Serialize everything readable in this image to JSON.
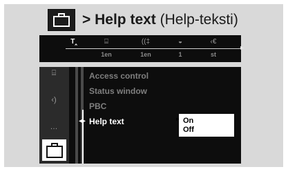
{
  "title": {
    "arrow": ">",
    "main": "Help text",
    "sub": "(Help-teksti)",
    "icon": "briefcase-icon"
  },
  "topbar": {
    "items": [
      {
        "icon": "settings-tools-icon",
        "glyph": "T‸",
        "label": "",
        "active": true
      },
      {
        "icon": "subtitle-icon",
        "glyph": "⌸",
        "label": "1en"
      },
      {
        "icon": "audio-language-icon",
        "glyph": "((‡",
        "label": "1en"
      },
      {
        "icon": "camera-angle-icon",
        "glyph": "◒",
        "label": "1"
      },
      {
        "icon": "sound-mode-icon",
        "glyph": "‹€",
        "label": "st"
      }
    ]
  },
  "sidebar": {
    "items": [
      {
        "icon": "display-icon",
        "glyph": "⌸"
      },
      {
        "icon": "speaker-icon",
        "glyph": "‹)"
      },
      {
        "icon": "subtitle-icon",
        "glyph": "…"
      },
      {
        "icon": "briefcase-icon",
        "selected": true
      }
    ]
  },
  "menu": {
    "items": [
      {
        "label": "Access control"
      },
      {
        "label": "Status window"
      },
      {
        "label": "PBC"
      },
      {
        "label": "Help text",
        "current": true
      }
    ]
  },
  "popup": {
    "options": [
      "On",
      "Off"
    ],
    "selected": "On"
  }
}
